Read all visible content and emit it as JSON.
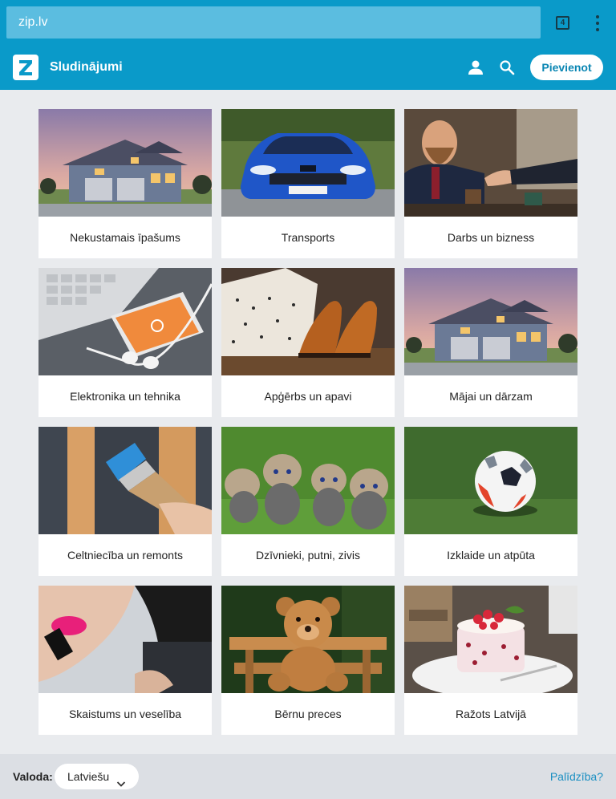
{
  "browser": {
    "url": "zip.lv",
    "tab_count": "4"
  },
  "app_bar": {
    "title": "Sludinājumi",
    "add_button": "Pievienot"
  },
  "categories": [
    {
      "label": "Nekustamais īpašums",
      "image": "house-photo"
    },
    {
      "label": "Transports",
      "image": "car-photo"
    },
    {
      "label": "Darbs un bizness",
      "image": "handshake-photo"
    },
    {
      "label": "Elektronika un tehnika",
      "image": "phone-photo"
    },
    {
      "label": "Apģērbs un apavi",
      "image": "shoes-photo"
    },
    {
      "label": "Mājai un dārzam",
      "image": "house-photo"
    },
    {
      "label": "Celtniecība un remonts",
      "image": "paintbrush-photo"
    },
    {
      "label": "Dzīvnieki, putni, zivis",
      "image": "kittens-photo"
    },
    {
      "label": "Izklaide un atpūta",
      "image": "football-photo"
    },
    {
      "label": "Skaistums un veselība",
      "image": "lipstick-photo"
    },
    {
      "label": "Bērnu preces",
      "image": "teddy-bear-photo"
    },
    {
      "label": "Ražots Latvijā",
      "image": "cake-photo"
    }
  ],
  "footer": {
    "language_label": "Valoda:",
    "language_value": "Latviešu",
    "help_link": "Palīdzība?"
  },
  "colors": {
    "brand": "#0a9ac9",
    "link": "#1a8fc2",
    "background": "#e9ebee"
  }
}
